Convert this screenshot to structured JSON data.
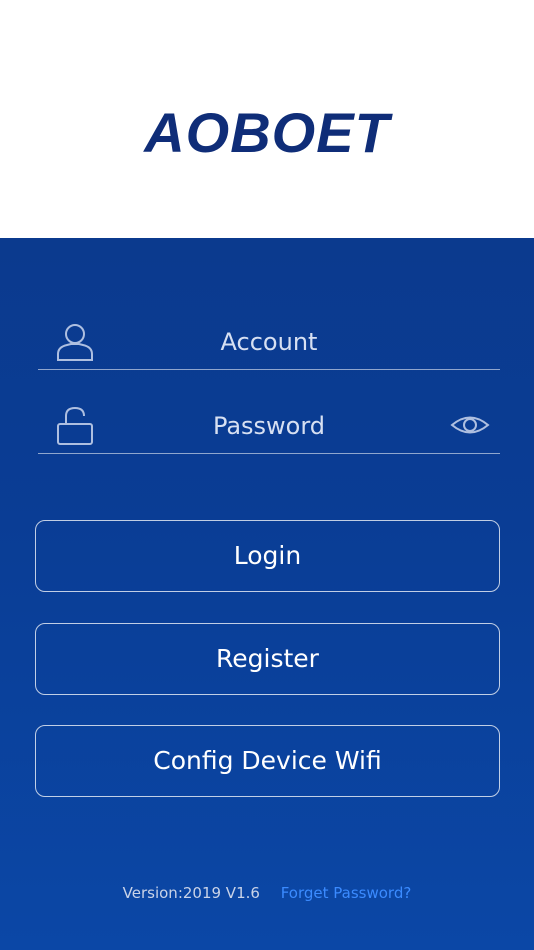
{
  "brand": {
    "logo_text": "AOBOET",
    "logo_color": "#0f2d78"
  },
  "login_form": {
    "account": {
      "placeholder": "Account",
      "icon": "user-icon"
    },
    "password": {
      "placeholder": "Password",
      "icon": "lock-icon",
      "toggle_icon": "eye-icon"
    }
  },
  "buttons": {
    "login": "Login",
    "register": "Register",
    "config_wifi": "Config Device Wifi"
  },
  "footer": {
    "version": "Version:2019 V1.6",
    "forget_password": "Forget Password?"
  },
  "colors": {
    "panel_background": "#0b3a8e",
    "link": "#3b8bff"
  }
}
